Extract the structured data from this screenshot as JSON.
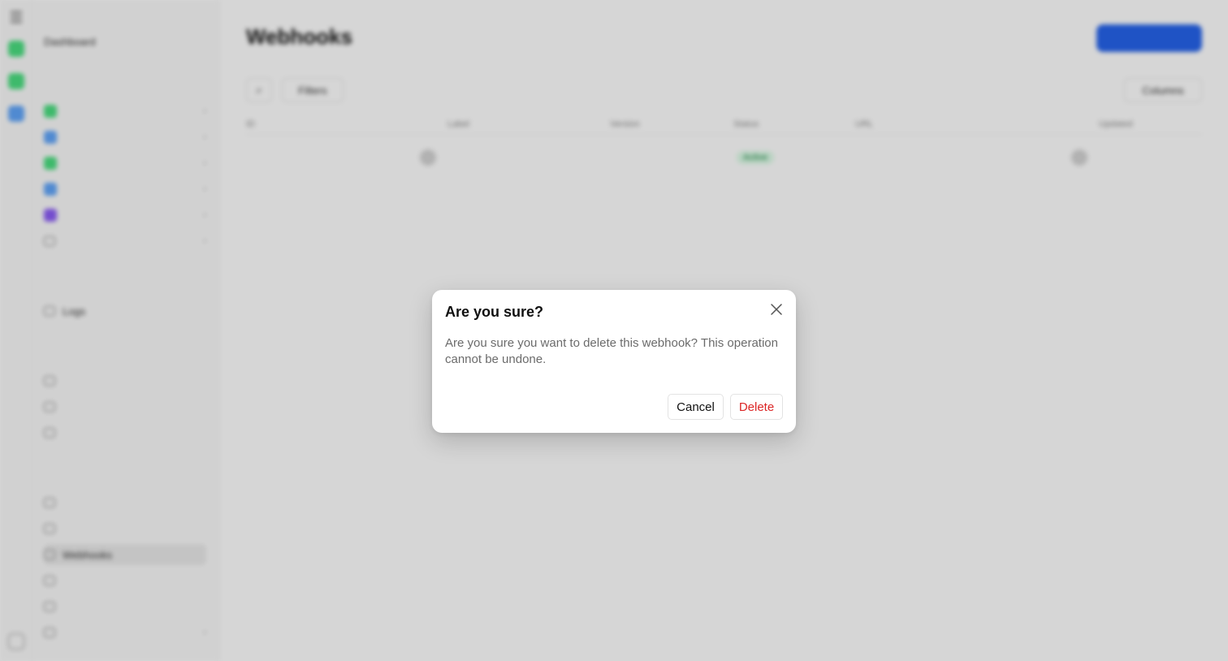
{
  "dialog": {
    "title": "Are you sure?",
    "message": "Are you sure you want to delete this webhook? This operation cannot be undone.",
    "cancel_label": "Cancel",
    "delete_label": "Delete",
    "close_icon": "close-icon"
  },
  "background": {
    "page_title": "Webhooks",
    "filter_label": "Filters",
    "columns_label": "Columns",
    "primary_button_label": "",
    "sidebar_active": "Webhooks",
    "sidebar_items": [
      "Dashboard",
      "Logs",
      "Webhooks"
    ],
    "table_headers": [
      "ID",
      "Label",
      "Version",
      "Status",
      "URL",
      "Updated"
    ],
    "row_status": "Active"
  },
  "colors": {
    "accent": "#2563eb",
    "danger": "#dc2626",
    "overlay": "rgba(0,0,0,0.16)"
  }
}
